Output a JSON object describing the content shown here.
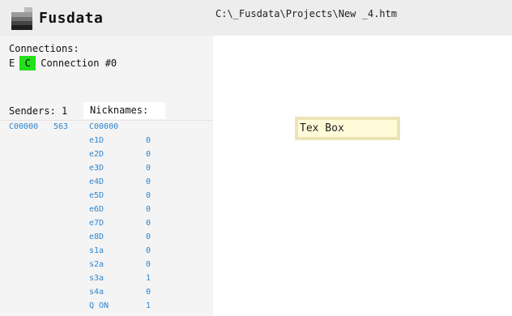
{
  "app": {
    "title": "Fusdata",
    "path": "C:\\_Fusdata\\Projects\\New _4.htm"
  },
  "connections": {
    "title": "Connections:",
    "e_label": "E",
    "c_label": "C",
    "c_color": "#22e01a",
    "name": "Connection #0"
  },
  "senders": {
    "label": "Senders: 1",
    "id": "C00000",
    "count": "563"
  },
  "nicknames": {
    "label": "Nicknames:",
    "header_id": "C00000",
    "items": [
      {
        "name": "e1D",
        "value": "0"
      },
      {
        "name": "e2D",
        "value": "0"
      },
      {
        "name": "e3D",
        "value": "0"
      },
      {
        "name": "e4D",
        "value": "0"
      },
      {
        "name": "e5D",
        "value": "0"
      },
      {
        "name": "e6D",
        "value": "0"
      },
      {
        "name": "e7D",
        "value": "0"
      },
      {
        "name": "e8D",
        "value": "0"
      },
      {
        "name": "s1a",
        "value": "0"
      },
      {
        "name": "s2a",
        "value": "0"
      },
      {
        "name": "s3a",
        "value": "1"
      },
      {
        "name": "s4a",
        "value": "0"
      },
      {
        "name": "Q ON",
        "value": "1"
      }
    ]
  },
  "canvas": {
    "text_box": "Tex Box"
  },
  "colors": {
    "accent_blue": "#2e86d1",
    "textbox_fill": "#fffbd9",
    "textbox_border": "#ede3b6"
  }
}
